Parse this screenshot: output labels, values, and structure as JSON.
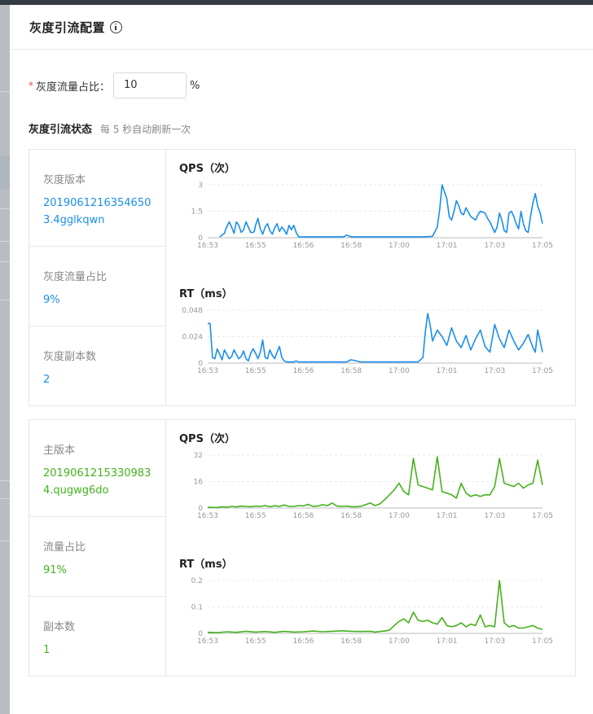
{
  "drawer": {
    "title": "灰度引流配置"
  },
  "form": {
    "label": "灰度流量占比：",
    "value": "10",
    "unit": "%"
  },
  "status": {
    "title": "灰度引流状态",
    "subtitle": "每 5 秒自动刷新一次"
  },
  "colors": {
    "canary": "#1b8eeb",
    "main": "#44b21c"
  },
  "canary": {
    "version_label": "灰度版本",
    "version_value": "20190612163546503.4gglkqwn",
    "ratio_label": "灰度流量占比",
    "ratio_value": "9%",
    "replicas_label": "灰度副本数",
    "replicas_value": "2"
  },
  "main": {
    "version_label": "主版本",
    "version_value": "20190612153309834.qugwg6do",
    "ratio_label": "流量占比",
    "ratio_value": "91%",
    "replicas_label": "副本数",
    "replicas_value": "1"
  },
  "chart_data": [
    {
      "id": "canary-qps",
      "type": "line",
      "title": "QPS（次）",
      "color": "#1b8eeb",
      "x_ticks": [
        "16:53",
        "16:55",
        "16:56",
        "16:58",
        "17:00",
        "17:01",
        "17:03",
        "17:05"
      ],
      "y_ticks": [
        "0",
        "1.5",
        "3"
      ],
      "ylim": [
        0,
        3
      ],
      "x_range": [
        0,
        140
      ],
      "grid": true,
      "series": [
        {
          "x": [
            5,
            6,
            7,
            7.6,
            8.4,
            9,
            10,
            11,
            12,
            13,
            14,
            15,
            16,
            17,
            18,
            19,
            19.5,
            20,
            21,
            22,
            23,
            24,
            25,
            26,
            27,
            28,
            29,
            30,
            31,
            32,
            33,
            34,
            35,
            36,
            37,
            38,
            40,
            42,
            46,
            50,
            54,
            56,
            57,
            58,
            60,
            65,
            70,
            72,
            74,
            76,
            78,
            80,
            84,
            90,
            94,
            96,
            97,
            98,
            100,
            101,
            102,
            103,
            104,
            105,
            106,
            107,
            108,
            110,
            112,
            113,
            114,
            116,
            117,
            118,
            120,
            121,
            122,
            123,
            124,
            125,
            126,
            127,
            128,
            129,
            130,
            131,
            132,
            133,
            134,
            135,
            136,
            137,
            138,
            139,
            140
          ],
          "y": [
            0.05,
            0.15,
            0.25,
            0.5,
            0.75,
            0.9,
            0.6,
            0.25,
            0.9,
            0.7,
            0.3,
            0.45,
            0.9,
            0.6,
            0.3,
            0.3,
            0.35,
            0.7,
            1.1,
            0.5,
            0.2,
            0.6,
            0.8,
            0.4,
            0.2,
            0.55,
            0.8,
            0.35,
            0.6,
            0.45,
            0.2,
            0.7,
            0.45,
            0.7,
            0.3,
            0.05,
            0.05,
            0.05,
            0.05,
            0.05,
            0.05,
            0.05,
            0.05,
            0.15,
            0.05,
            0.05,
            0.05,
            0.05,
            0.05,
            0.05,
            0.05,
            0.05,
            0.05,
            0.05,
            0.08,
            0.6,
            1.6,
            3.0,
            2.2,
            1.2,
            1.0,
            1.5,
            2.1,
            1.8,
            1.4,
            1.3,
            1.7,
            1.2,
            1.0,
            1.3,
            1.5,
            1.4,
            1.1,
            0.9,
            0.3,
            0.6,
            1.4,
            1.0,
            0.4,
            0.3,
            1.4,
            1.5,
            1.2,
            0.8,
            0.5,
            1.5,
            0.8,
            0.4,
            0.3,
            1.2,
            2.0,
            2.5,
            1.8,
            1.4,
            0.8
          ]
        }
      ]
    },
    {
      "id": "canary-rt",
      "type": "line",
      "title": "RT（ms）",
      "color": "#1b8eeb",
      "x_ticks": [
        "16:53",
        "16:55",
        "16:56",
        "16:58",
        "17:00",
        "17:01",
        "17:03",
        "17:05"
      ],
      "y_ticks": [
        "0",
        "0.024",
        "0.048"
      ],
      "ylim": [
        0,
        0.048
      ],
      "x_range": [
        0,
        140
      ],
      "grid": true,
      "series": [
        {
          "x": [
            0,
            1,
            2,
            3,
            4,
            5,
            6,
            7,
            8,
            9,
            10,
            11,
            12,
            13,
            14,
            15,
            16,
            17,
            18,
            19,
            20,
            21,
            22,
            23,
            24,
            25,
            26,
            27,
            28,
            29,
            30,
            31,
            32,
            33,
            34,
            35,
            36,
            37,
            38,
            40,
            46,
            50,
            52,
            54,
            56,
            58,
            60,
            64,
            70,
            72,
            74,
            76,
            78,
            80,
            82,
            84,
            86,
            88,
            90,
            91,
            92,
            93,
            94,
            96,
            98,
            100,
            102,
            104,
            106,
            108,
            110,
            112,
            114,
            116,
            118,
            120,
            122,
            124,
            126,
            128,
            130,
            132,
            134,
            136,
            137,
            138,
            139,
            140
          ],
          "y": [
            0.036,
            0.036,
            0.005,
            0.004,
            0.013,
            0.008,
            0.003,
            0.012,
            0.008,
            0.004,
            0.006,
            0.012,
            0.008,
            0.004,
            0.006,
            0.011,
            0.004,
            0.002,
            0.009,
            0.013,
            0.009,
            0.004,
            0.01,
            0.021,
            0.005,
            0.004,
            0.012,
            0.007,
            0.004,
            0.01,
            0.015,
            0.005,
            0.002,
            0.001,
            0.001,
            0.001,
            0.001,
            0.002,
            0.001,
            0.001,
            0.001,
            0.001,
            0.001,
            0.001,
            0.001,
            0.001,
            0.003,
            0.001,
            0.001,
            0.001,
            0.001,
            0.001,
            0.001,
            0.001,
            0.001,
            0.001,
            0.001,
            0.001,
            0.005,
            0.028,
            0.045,
            0.035,
            0.02,
            0.03,
            0.024,
            0.016,
            0.032,
            0.02,
            0.014,
            0.025,
            0.012,
            0.022,
            0.03,
            0.015,
            0.01,
            0.035,
            0.022,
            0.014,
            0.03,
            0.02,
            0.012,
            0.018,
            0.026,
            0.014,
            0.01,
            0.03,
            0.02,
            0.01
          ]
        }
      ]
    },
    {
      "id": "main-qps",
      "type": "line",
      "title": "QPS（次）",
      "color": "#44b21c",
      "x_ticks": [
        "16:53",
        "16:55",
        "16:56",
        "16:58",
        "17:00",
        "17:01",
        "17:03",
        "17:05"
      ],
      "y_ticks": [
        "0",
        "16",
        "32"
      ],
      "ylim": [
        0,
        32
      ],
      "x_range": [
        0,
        140
      ],
      "grid": true,
      "series": [
        {
          "x": [
            0,
            4,
            6,
            8,
            10,
            12,
            14,
            16,
            18,
            20,
            22,
            24,
            26,
            28,
            30,
            32,
            34,
            36,
            38,
            40,
            42,
            44,
            46,
            48,
            50,
            52,
            54,
            56,
            58,
            60,
            62,
            64,
            66,
            68,
            70,
            72,
            74,
            76,
            78,
            80,
            82,
            84,
            86,
            88,
            90,
            92,
            94,
            96,
            98,
            100,
            102,
            104,
            106,
            108,
            110,
            112,
            114,
            116,
            118,
            120,
            122,
            124,
            126,
            128,
            130,
            132,
            134,
            136,
            138,
            140
          ],
          "y": [
            0.5,
            0.3,
            0.8,
            0.5,
            1.0,
            0.7,
            1.2,
            1.0,
            0.8,
            1.2,
            1.0,
            1.5,
            0.8,
            1.4,
            1.0,
            1.8,
            1.0,
            1.0,
            1.5,
            1.3,
            2.2,
            1.0,
            1.2,
            2.0,
            1.5,
            3.0,
            1.2,
            1.0,
            1.2,
            0.8,
            0.8,
            1.0,
            2.0,
            3.0,
            1.5,
            2.5,
            5.0,
            8.0,
            11.0,
            15.0,
            10.0,
            8.0,
            30.0,
            14.0,
            13.0,
            12.0,
            11.0,
            31.0,
            10.0,
            9.0,
            8.0,
            6.0,
            15.0,
            9.0,
            7.0,
            8.0,
            7.0,
            8.0,
            8.0,
            13.0,
            30.0,
            15.0,
            14.0,
            13.0,
            15.0,
            12.0,
            14.0,
            15.0,
            29.0,
            14.0
          ]
        }
      ]
    },
    {
      "id": "main-rt",
      "type": "line",
      "title": "RT（ms）",
      "color": "#44b21c",
      "x_ticks": [
        "16:53",
        "16:55",
        "16:56",
        "16:58",
        "17:00",
        "17:01",
        "17:03",
        "17:05"
      ],
      "y_ticks": [
        "0",
        "0.1",
        "0.2"
      ],
      "ylim": [
        0,
        0.2
      ],
      "x_range": [
        0,
        140
      ],
      "grid": true,
      "series": [
        {
          "x": [
            0,
            4,
            8,
            12,
            16,
            20,
            24,
            28,
            32,
            36,
            40,
            44,
            48,
            52,
            56,
            60,
            64,
            68,
            70,
            72,
            74,
            76,
            78,
            80,
            82,
            84,
            86,
            88,
            90,
            92,
            94,
            96,
            98,
            100,
            102,
            104,
            106,
            108,
            110,
            112,
            114,
            116,
            118,
            120,
            122,
            124,
            126,
            128,
            130,
            132,
            134,
            136,
            138,
            140
          ],
          "y": [
            0.004,
            0.003,
            0.006,
            0.004,
            0.008,
            0.005,
            0.007,
            0.004,
            0.008,
            0.005,
            0.006,
            0.009,
            0.006,
            0.008,
            0.01,
            0.008,
            0.007,
            0.008,
            0.005,
            0.007,
            0.009,
            0.012,
            0.03,
            0.045,
            0.055,
            0.04,
            0.08,
            0.05,
            0.045,
            0.05,
            0.04,
            0.035,
            0.06,
            0.03,
            0.025,
            0.03,
            0.04,
            0.025,
            0.035,
            0.03,
            0.07,
            0.025,
            0.03,
            0.025,
            0.2,
            0.04,
            0.025,
            0.03,
            0.02,
            0.02,
            0.025,
            0.03,
            0.02,
            0.015
          ]
        }
      ]
    }
  ]
}
